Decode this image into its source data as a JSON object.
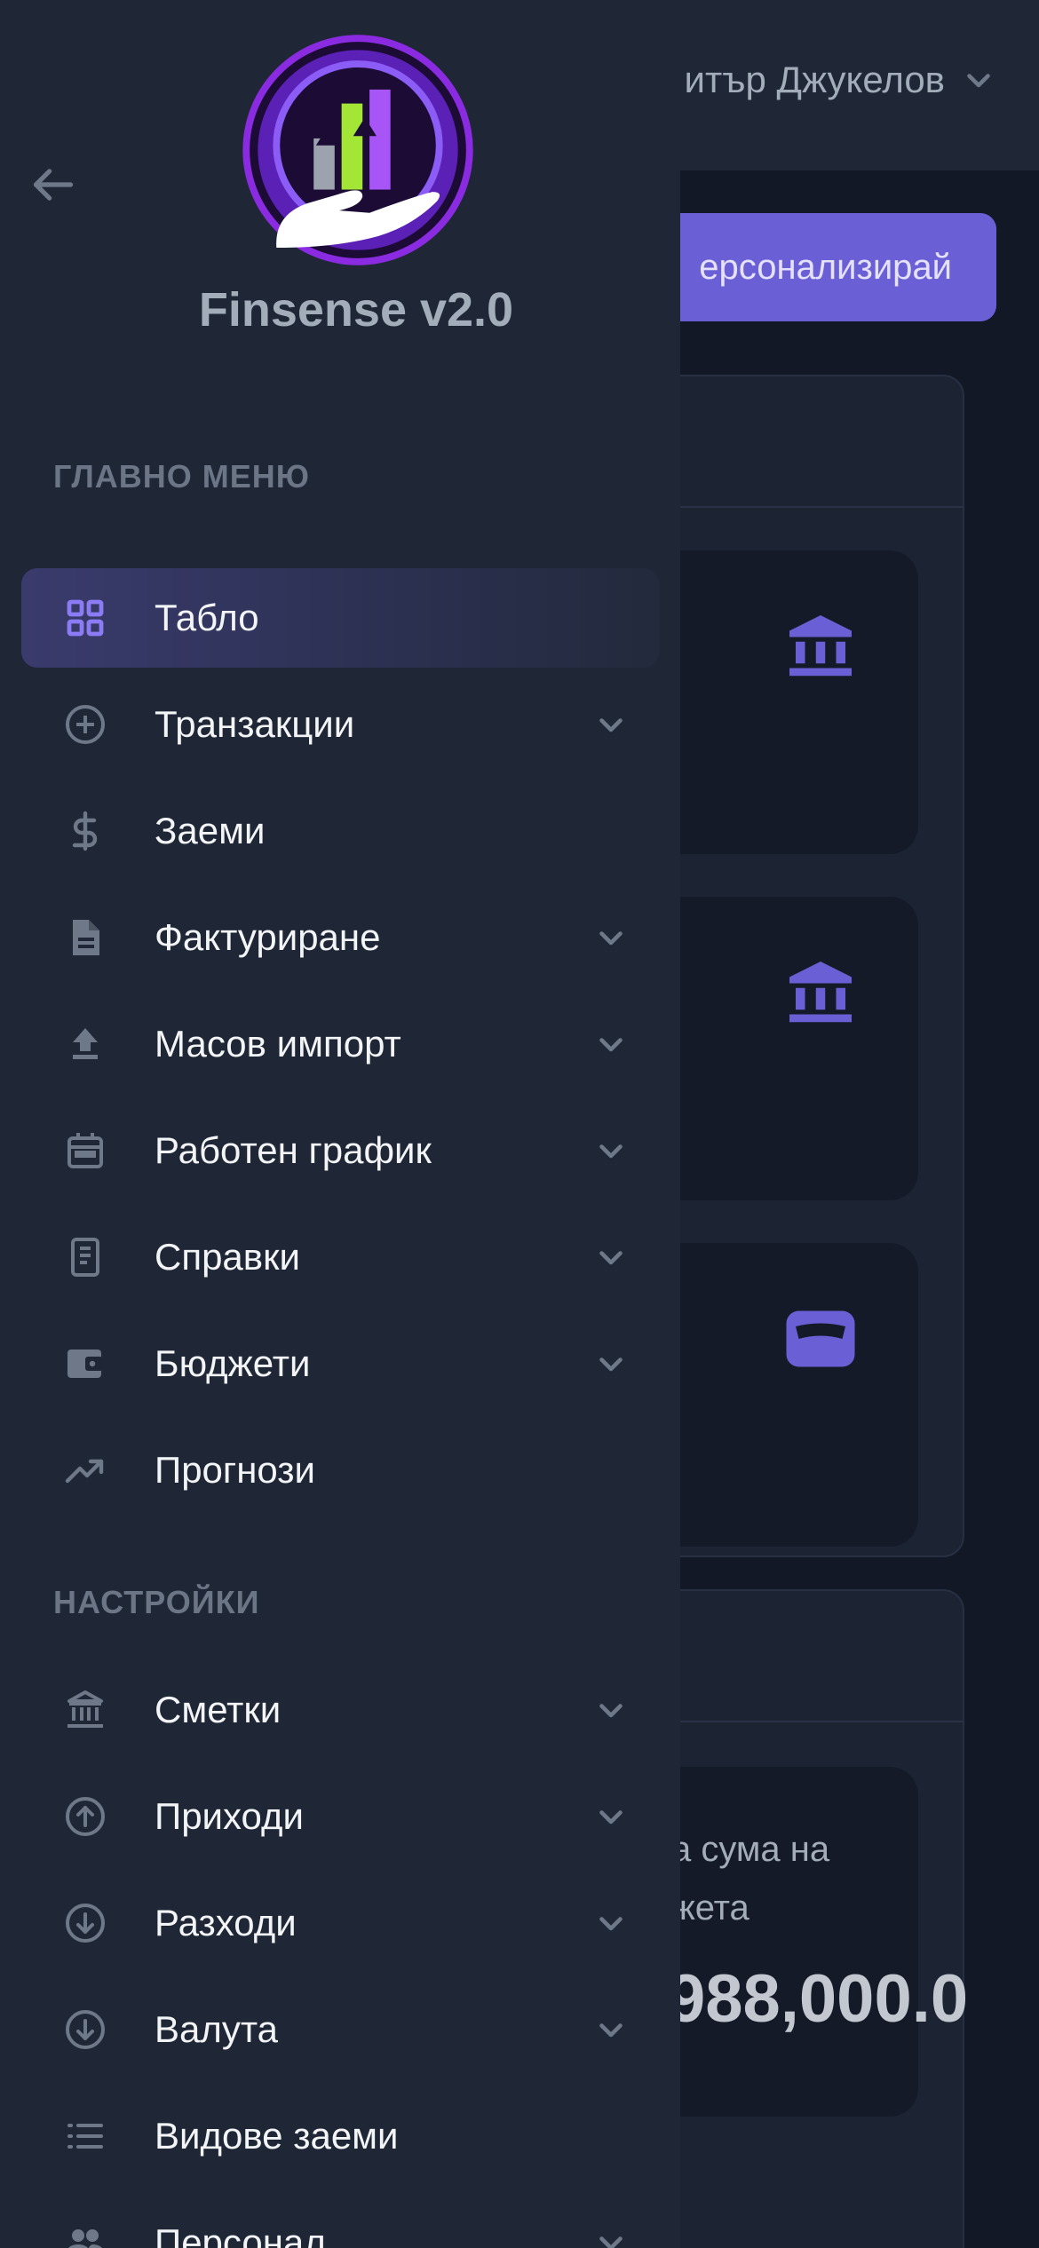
{
  "app": {
    "name": "Finsense v2.0"
  },
  "background": {
    "user_name": "итър Джукелов",
    "customize_button": "ерсонализирай",
    "card1_partial": "а",
    "sum_label_line1": "а сума на",
    "sum_label_line2": "жета",
    "sum_value": "988,000.0"
  },
  "sidebar": {
    "main_section_title": "ГЛАВНО МЕНЮ",
    "settings_section_title": "НАСТРОЙКИ",
    "main_items": [
      {
        "label": "Табло",
        "icon": "dashboard-grid-icon",
        "active": true,
        "has_submenu": false
      },
      {
        "label": "Транзакции",
        "icon": "plus-circle-icon",
        "has_submenu": true
      },
      {
        "label": "Заеми",
        "icon": "dollar-icon",
        "has_submenu": false
      },
      {
        "label": "Фактуриране",
        "icon": "document-icon",
        "has_submenu": true
      },
      {
        "label": "Масов импорт",
        "icon": "upload-icon",
        "has_submenu": true
      },
      {
        "label": "Работен график",
        "icon": "calendar-icon",
        "has_submenu": true
      },
      {
        "label": "Справки",
        "icon": "report-icon",
        "has_submenu": true
      },
      {
        "label": "Бюджети",
        "icon": "wallet-icon",
        "has_submenu": true
      },
      {
        "label": "Прогнози",
        "icon": "trending-up-icon",
        "has_submenu": false
      }
    ],
    "settings_items": [
      {
        "label": "Сметки",
        "icon": "bank-icon",
        "has_submenu": true
      },
      {
        "label": "Приходи",
        "icon": "arrow-up-circle-icon",
        "has_submenu": true
      },
      {
        "label": "Разходи",
        "icon": "arrow-down-circle-icon",
        "has_submenu": true
      },
      {
        "label": "Валута",
        "icon": "arrow-down-circle-icon",
        "has_submenu": true
      },
      {
        "label": "Видове заеми",
        "icon": "list-icon",
        "has_submenu": false
      },
      {
        "label": "Персонал",
        "icon": "people-icon",
        "has_submenu": true
      }
    ]
  },
  "colors": {
    "accent": "#6b5fd6",
    "sidebar_bg": "#1f2737",
    "page_bg": "#121826",
    "icon_gray": "#6f7889",
    "active_icon": "#8b7cf6"
  }
}
